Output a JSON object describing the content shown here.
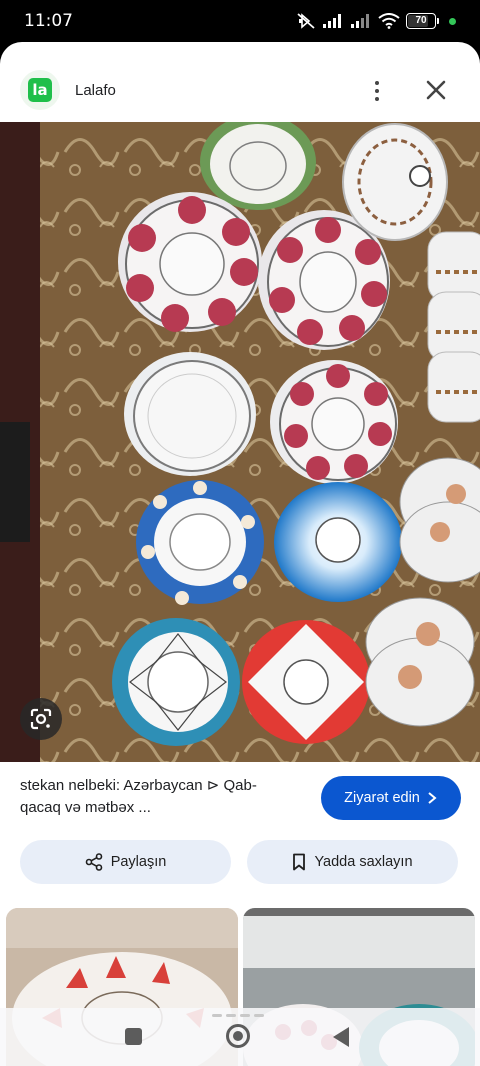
{
  "status_bar": {
    "time": "11:07",
    "battery": "70",
    "icons": [
      "mute-icon",
      "signal-icon",
      "signal-icon",
      "wifi-icon",
      "battery-icon"
    ]
  },
  "header": {
    "site_name": "Lalafo",
    "logo_text": "la",
    "icons": [
      "more-vert-icon",
      "close-icon"
    ]
  },
  "result": {
    "caption": "stekan nelbeki: Azərbaycan ⊳ Qab-qacaq və mətbəx ...",
    "visit_label": "Ziyarət edin",
    "share_label": "Paylaşın",
    "save_label": "Yadda saxlayın"
  },
  "colors": {
    "accent": "#0b57d0",
    "chip_bg": "#e8eef8",
    "logo_green": "#1fbf4a",
    "tablecloth": "#8a6a45"
  }
}
